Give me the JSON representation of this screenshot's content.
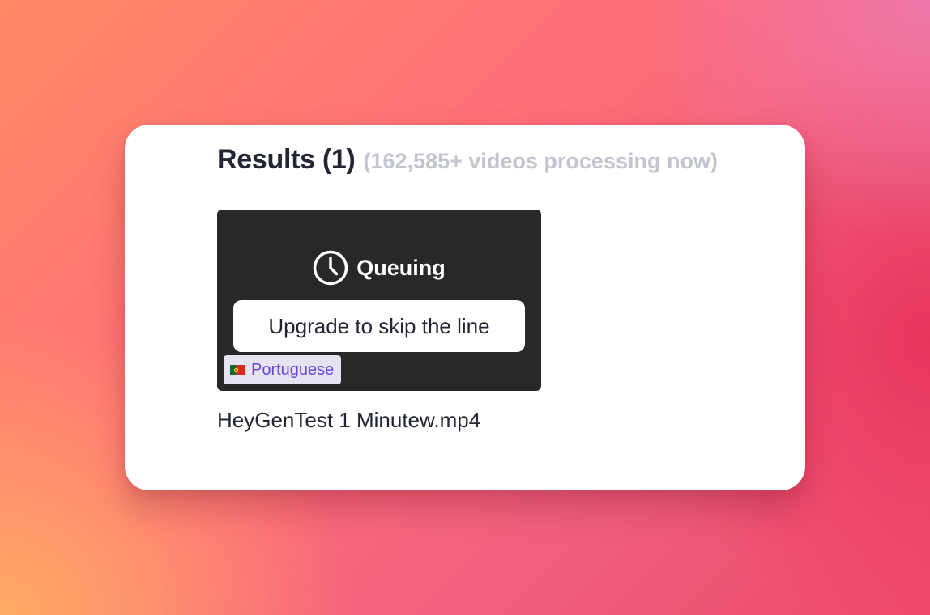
{
  "results": {
    "title": "Results (1)",
    "processing_note": "(162,585+ videos processing now)"
  },
  "video": {
    "status_icon": "clock-icon",
    "status_label": "Queuing",
    "upgrade_label": "Upgrade to skip the line",
    "language_flag": "portugal-flag-icon",
    "language_label": "Portuguese",
    "file_name": "HeyGenTest 1 Minutew.mp4"
  },
  "colors": {
    "card_background": "#ffffff",
    "tile_background": "#282828",
    "heading_text": "#222634",
    "muted_text": "#c2c5cf",
    "badge_background": "#e4e3ef",
    "badge_text": "#6b47dc"
  }
}
